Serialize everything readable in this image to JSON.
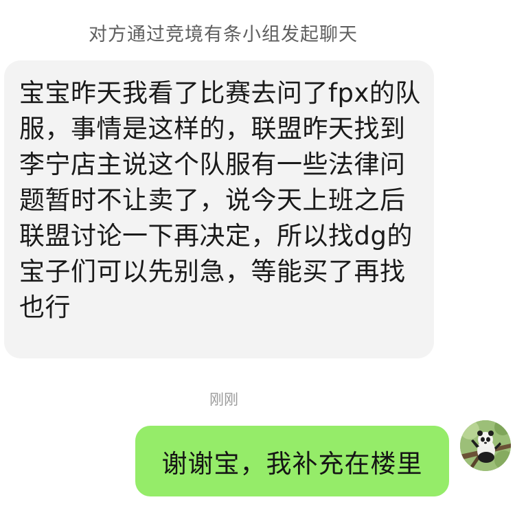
{
  "notice": {
    "text": "对方通过竞境有条小组发起聊天"
  },
  "messages": {
    "incoming": {
      "text": "宝宝昨天我看了比赛去问了fpx的队服，事情是这样的，联盟昨天找到李宁店主说这个队服有一些法律问题暂时不让卖了，说今天上班之后联盟讨论一下再决定，所以找dg的宝子们可以先别急，等能买了再找也行"
    },
    "timestamp": "刚刚",
    "outgoing": {
      "text": "谢谢宝，我补充在楼里"
    }
  },
  "avatar": {
    "icon": "panda-on-branch-avatar"
  },
  "colors": {
    "incoming_bubble": "#f3f3f3",
    "outgoing_bubble": "#95ec69",
    "notice_text": "#5f5f5f",
    "timestamp_text": "#9a9a9a"
  }
}
